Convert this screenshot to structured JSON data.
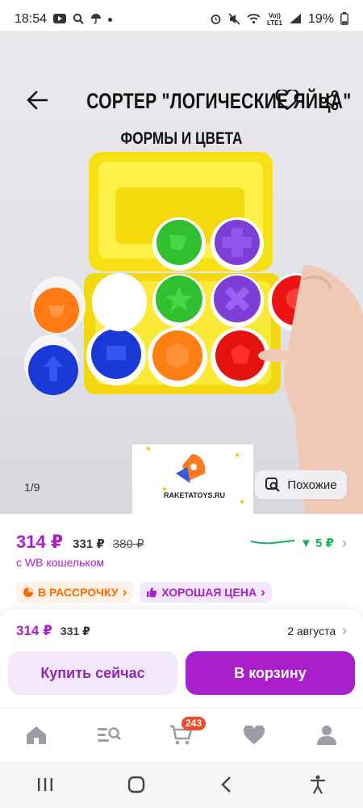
{
  "status_bar": {
    "time": "18:54",
    "battery": "19%",
    "network_label": "LTE1"
  },
  "gallery": {
    "title": "СОРТЕР \"ЛОГИЧЕСКИЕ ЯЙЦА\"",
    "subtitle": "ФОРМЫ И ЦВЕТА",
    "counter": "1/9",
    "similar_label": "Похожие",
    "card_brand": "RAKETATOYS.RU"
  },
  "price": {
    "current": "314 ₽",
    "old": "331 ₽",
    "strikethrough": "380 ₽",
    "drop": "▼ 5 ₽",
    "wallet_note": "с WB кошельком"
  },
  "chips": [
    {
      "label": "В РАССРОЧКУ",
      "icon": "pie-icon"
    },
    {
      "label": "ХОРОШАЯ ЦЕНА",
      "icon": "thumbs-up-icon"
    }
  ],
  "buy_sheet": {
    "price": "314 ₽",
    "old_price": "331 ₽",
    "delivery_date": "2 августа",
    "buy_now": "Купить сейчас",
    "add_to_cart": "В корзину"
  },
  "bottom_nav": {
    "cart_badge": "243"
  },
  "colors": {
    "accent": "#a81fcb",
    "accent_light": "#f3e8fb",
    "orange": "#ff6a00",
    "green_trend": "#17b160",
    "badge": "#f24c2c"
  }
}
